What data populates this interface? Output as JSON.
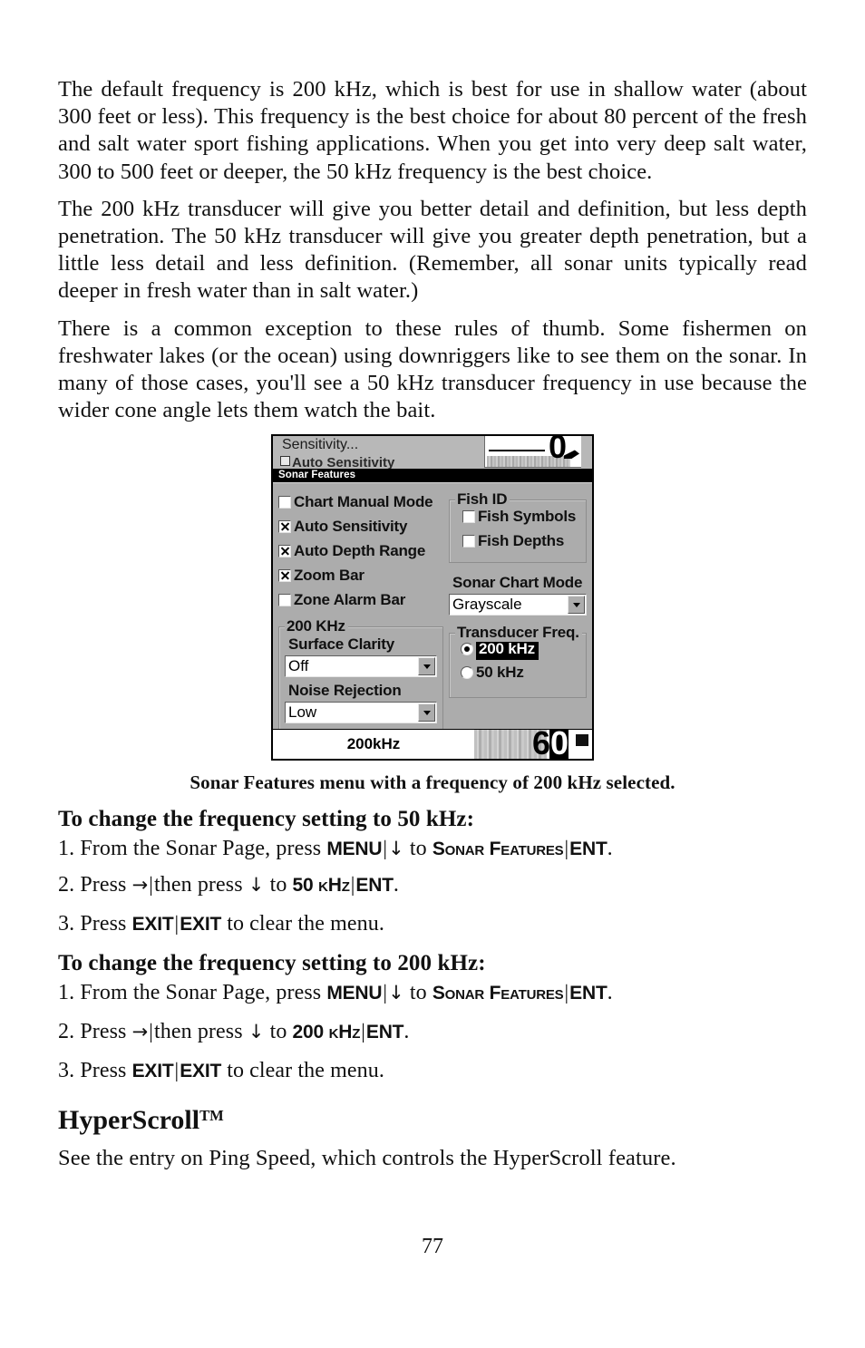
{
  "page": {
    "number": "77"
  },
  "paragraphs": [
    "The default frequency is 200 kHz, which is best for use in shallow water (about 300 feet or less). This frequency is the best choice for about 80 percent of the fresh and salt water sport fishing applications. When you get into very deep salt water, 300 to 500 feet or deeper, the 50 kHz frequency is the best choice.",
    "The 200 kHz transducer will give you better detail and definition, but less depth penetration. The 50 kHz transducer will give you greater depth penetration, but a little less detail and less definition. (Remember, all sonar units typically read deeper in fresh water than in salt water.)",
    "There is a common exception to these rules of thumb. Some fishermen on freshwater lakes (or the ocean) using downriggers like to see them on the sonar. In many of those cases, you'll see a 50 kHz transducer frequency in use because the wider cone angle lets them watch the bait."
  ],
  "sonar_screenshot": {
    "background_menu": {
      "item1": "Sensitivity...",
      "item2": "Auto Sensitivity",
      "readout": "0"
    },
    "title": "Sonar Features",
    "checkboxes": [
      {
        "label": "Chart Manual Mode",
        "checked": false
      },
      {
        "label": "Auto Sensitivity",
        "checked": true
      },
      {
        "label": "Auto Depth Range",
        "checked": true
      },
      {
        "label": "Zoom Bar",
        "checked": true
      },
      {
        "label": "Zone Alarm Bar",
        "checked": false
      }
    ],
    "fish_id": {
      "title": "Fish ID",
      "options": [
        {
          "label": "Fish Symbols",
          "checked": false
        },
        {
          "label": "Fish Depths",
          "checked": false
        }
      ]
    },
    "sonar_chart_mode": {
      "label": "Sonar Chart Mode",
      "value": "Grayscale"
    },
    "khz_group": {
      "title": "200 KHz",
      "surface_clarity": {
        "label": "Surface Clarity",
        "value": "Off"
      },
      "noise_rejection": {
        "label": "Noise Rejection",
        "value": "Low"
      }
    },
    "transducer_freq": {
      "title": "Transducer Freq.",
      "options": [
        {
          "label": "200 kHz",
          "selected": true
        },
        {
          "label": "50 kHz",
          "selected": false
        }
      ]
    },
    "statusbar": {
      "frequency": "200kHz",
      "depth": "60"
    }
  },
  "caption": "Sonar Features menu with a frequency of 200 kHz selected.",
  "section_50khz": {
    "heading": "To change the frequency setting to 50 kHz:",
    "steps": [
      {
        "number": "1.",
        "pre": "From the Sonar Page, press ",
        "key1": "MENU",
        "sep1": "|",
        "arrow": "↓",
        "mid": " to ",
        "key2": "Sonar Features",
        "sep2": "|",
        "key3": "ENT",
        "post": "."
      },
      {
        "number": "2.",
        "pre": "Press ",
        "arrow1": "→",
        "sep1": "|",
        "mid1": "then press ",
        "arrow2": "↓",
        "mid2": " to ",
        "key1": "50 kHz",
        "sep2": "|",
        "key2": "ENT",
        "post": "."
      },
      {
        "number": "3.",
        "pre": "Press ",
        "key1": "EXIT",
        "sep1": "|",
        "key2": "EXIT",
        "post": " to clear the menu."
      }
    ]
  },
  "section_200khz": {
    "heading": "To change the frequency setting to 200 kHz:",
    "steps": [
      {
        "number": "1.",
        "pre": "From the Sonar Page, press ",
        "key1": "MENU",
        "sep1": "|",
        "arrow": "↓",
        "mid": " to ",
        "key2": "Sonar Features",
        "sep2": "|",
        "key3": "ENT",
        "post": "."
      },
      {
        "number": "2.",
        "pre": "Press ",
        "arrow1": "→",
        "sep1": "|",
        "mid1": "then press ",
        "arrow2": "↓",
        "mid2": " to ",
        "key1": "200 kHz",
        "sep2": "|",
        "key2": "ENT",
        "post": "."
      },
      {
        "number": "3.",
        "pre": "Press ",
        "key1": "EXIT",
        "sep1": "|",
        "key2": "EXIT",
        "post": " to clear the menu."
      }
    ]
  },
  "hyperscroll": {
    "heading": "HyperScroll",
    "heading_sup": "TM",
    "body": "See the entry on Ping Speed, which controls the HyperScroll feature."
  }
}
